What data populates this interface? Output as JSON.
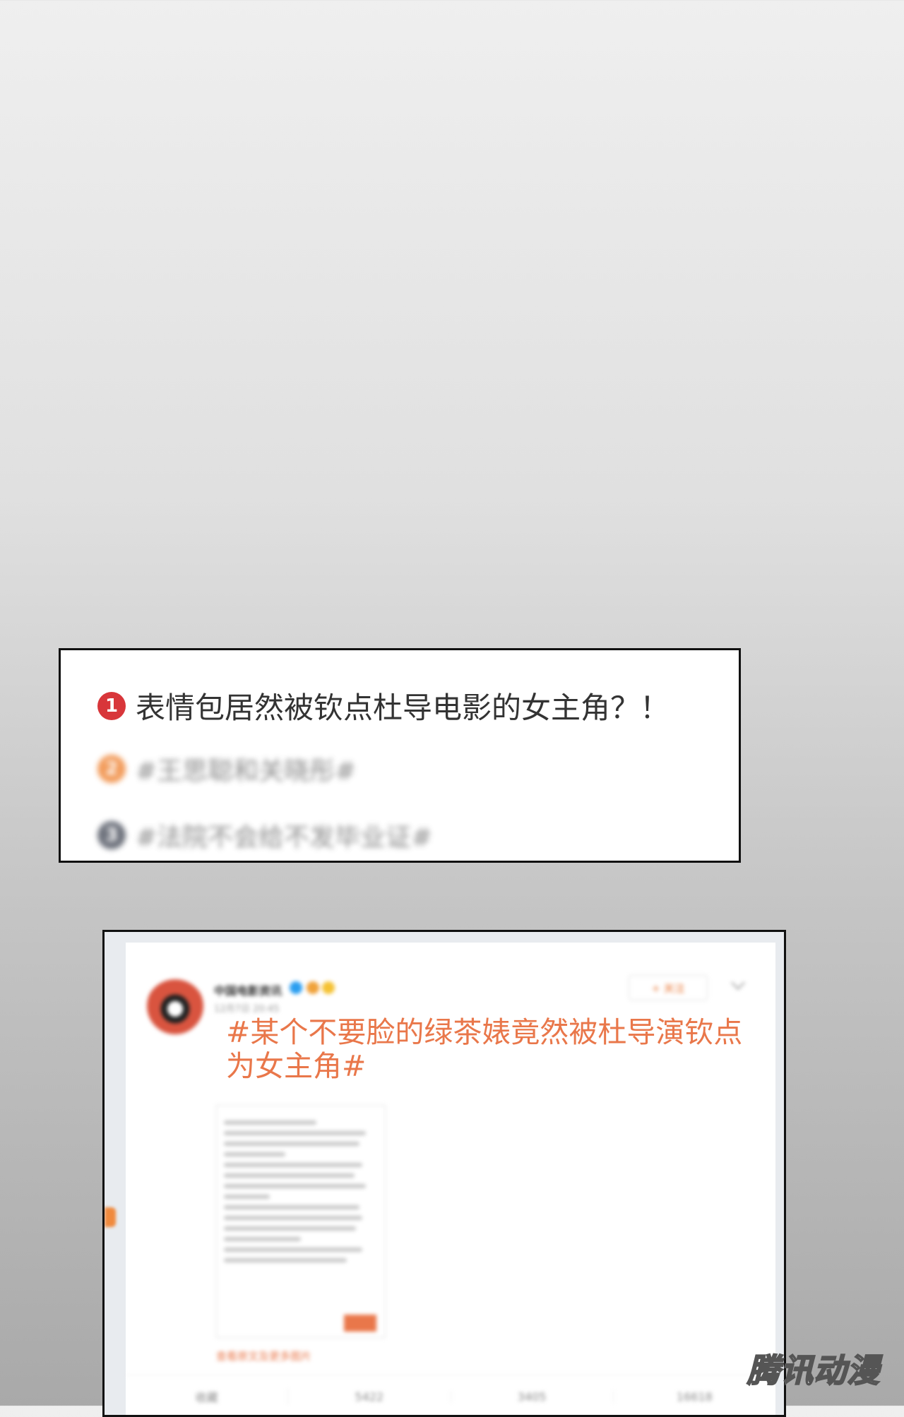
{
  "trending": {
    "items": [
      {
        "rank": "1",
        "color": "#d8363a",
        "title": "表情包居然被钦点杜导电影的女主角？！"
      },
      {
        "rank": "2",
        "color": "#f08a3e",
        "title": "#王思聪和关晓彤#"
      },
      {
        "rank": "3",
        "color": "#555a66",
        "title": "#法院不会给不发毕业证#"
      }
    ]
  },
  "post": {
    "user_name": "中国电影资讯",
    "time": "12月7日 20:45",
    "follow_label": "+ 关注",
    "headline": "#某个不要脸的绿茶婊竟然被杜导演钦点为女主角#",
    "original_link": "查看原文及更多图片",
    "actions": [
      "收藏",
      "5422",
      "3405",
      "16618"
    ]
  },
  "watermark": "腾讯动漫",
  "colors": {
    "accent": "#e9774a",
    "rank1": "#d8363a"
  }
}
